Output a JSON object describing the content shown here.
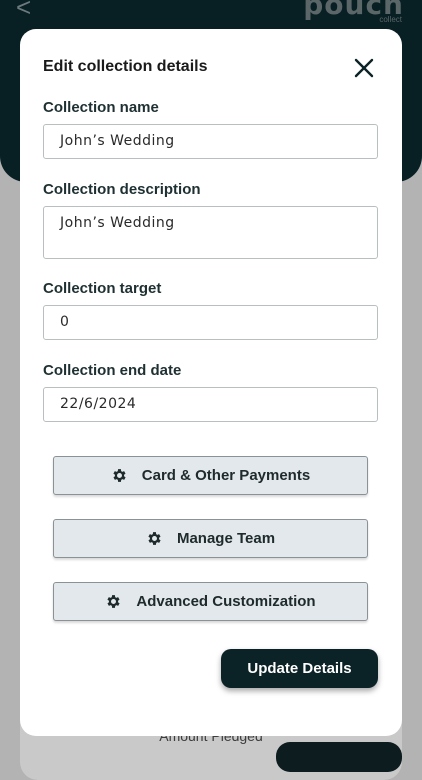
{
  "background": {
    "back_glyph": "<",
    "logo_main": "pouch",
    "logo_sub": "collect",
    "amount_label": "Amount Pledged"
  },
  "modal": {
    "title": "Edit collection details",
    "close_icon": "close-icon",
    "fields": {
      "name": {
        "label": "Collection name",
        "value": "John’s Wedding"
      },
      "description": {
        "label": "Collection description",
        "value": "John’s Wedding"
      },
      "target": {
        "label": "Collection target",
        "value": "0"
      },
      "end_date": {
        "label": "Collection end date",
        "value": "22/6/2024"
      }
    },
    "actions": [
      {
        "label": "Card & Other Payments",
        "icon": "gear-icon"
      },
      {
        "label": "Manage Team",
        "icon": "gear-icon"
      },
      {
        "label": "Advanced Customization",
        "icon": "gear-icon"
      }
    ],
    "submit_label": "Update Details"
  },
  "colors": {
    "primary_dark": "#0b2227",
    "button_bg": "#e3e8ec",
    "overlay": "#b3b3b3"
  }
}
